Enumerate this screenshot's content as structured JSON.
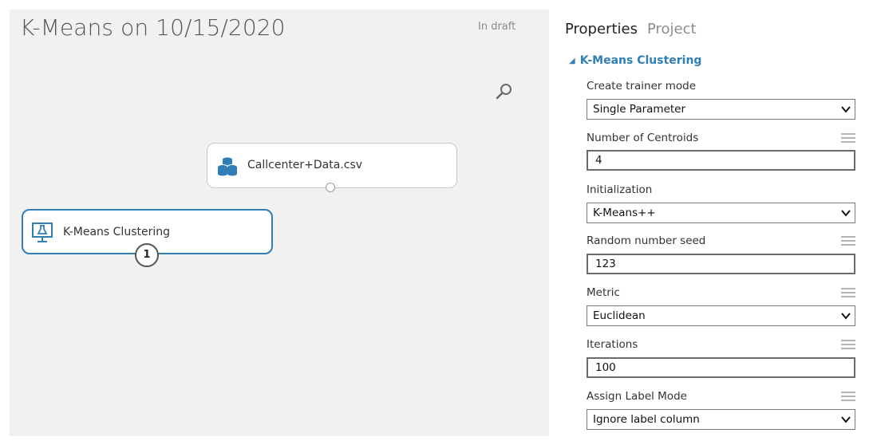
{
  "experiment": {
    "title": "K-Means on 10/15/2020",
    "status": "In draft"
  },
  "canvas": {
    "modules": [
      {
        "label": "Callcenter+Data.csv",
        "icon": "dataset-icon"
      },
      {
        "label": "K-Means Clustering",
        "icon": "clustering-model-icon",
        "port_number": "1"
      }
    ]
  },
  "panel": {
    "tabs": [
      "Properties",
      "Project"
    ],
    "section_title": "K-Means Clustering",
    "fields": {
      "trainer_mode": {
        "label": "Create trainer mode",
        "value": "Single Parameter"
      },
      "centroids": {
        "label": "Number of Centroids",
        "value": "4"
      },
      "initialization": {
        "label": "Initialization",
        "value": "K-Means++"
      },
      "seed": {
        "label": "Random number seed",
        "value": "123"
      },
      "metric": {
        "label": "Metric",
        "value": "Euclidean"
      },
      "iterations": {
        "label": "Iterations",
        "value": "100"
      },
      "label_mode": {
        "label": "Assign Label Mode",
        "value": "Ignore label column"
      }
    }
  },
  "colors": {
    "accent": "#2f7fb6",
    "canvas_bg": "#f1f1f1"
  }
}
